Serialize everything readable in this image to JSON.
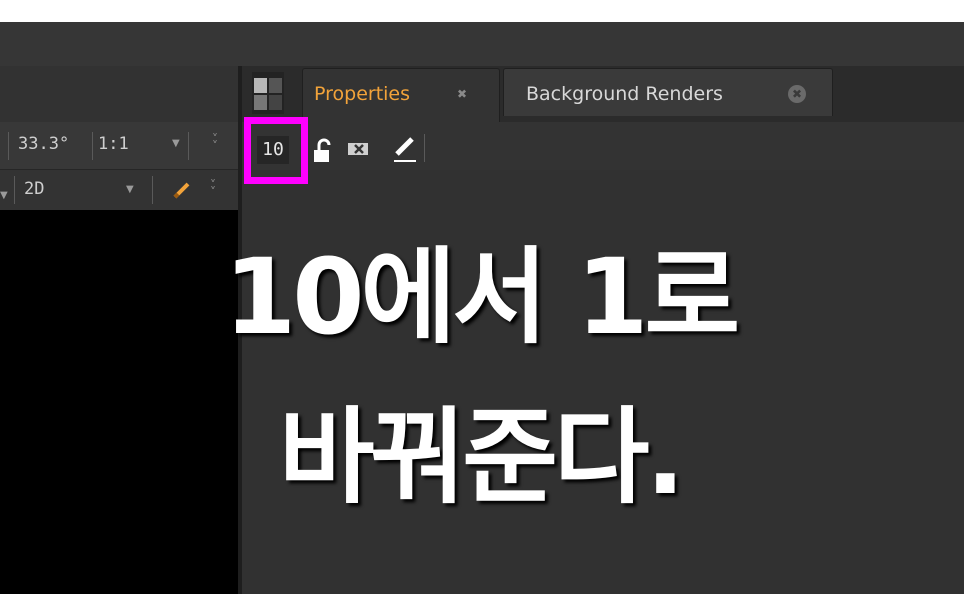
{
  "viewer": {
    "zoom": "33.3°",
    "ratio": "1:1",
    "view_mode": "2D"
  },
  "tabs": [
    {
      "label": "Properties",
      "active": true,
      "color": "#f2a33a"
    },
    {
      "label": "Background Renders",
      "active": false,
      "color": "#d8d8d8"
    }
  ],
  "properties_toolbar": {
    "max_panels": "10",
    "icons": [
      "lock-icon",
      "clear-panels-icon",
      "pen-icon"
    ]
  },
  "overlay_caption": {
    "line1": "10에서 1로",
    "line2": "바꿔준다."
  },
  "colors": {
    "highlight": "#ff00ff",
    "active_tab_text": "#f2a33a",
    "dropper": "#f2a33a"
  }
}
